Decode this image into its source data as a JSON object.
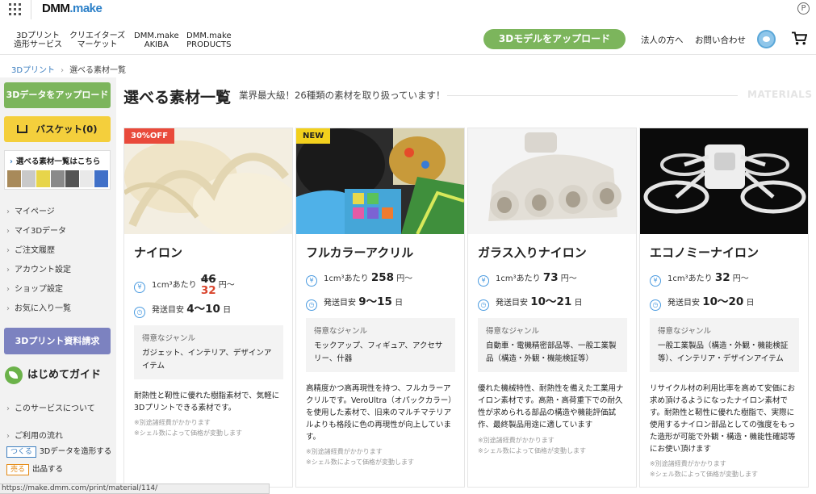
{
  "header": {
    "logo_main": "DMM",
    "logo_accent": ".make",
    "point_icon": "P",
    "nav": [
      {
        "line1": "3Dプリント",
        "line2": "造形サービス"
      },
      {
        "line1": "クリエイターズ",
        "line2": "マーケット"
      },
      {
        "line1": "DMM.make",
        "line2": "AKIBA"
      },
      {
        "line1": "DMM.make",
        "line2": "PRODUCTS"
      }
    ],
    "upload_button": "3Dモデルをアップロード",
    "corporate_link": "法人の方へ",
    "contact_link": "お問い合わせ"
  },
  "breadcrumb": {
    "home": "3Dプリント",
    "current": "選べる素材一覧"
  },
  "sidebar": {
    "upload_button": "3Dデータをアップロード",
    "basket_button": "バスケット(0)",
    "material_banner": "選べる素材一覧はこちら",
    "menu": [
      "マイページ",
      "マイ3Dデータ",
      "ご注文履歴",
      "アカウント設定",
      "ショップ設定",
      "お気に入り一覧"
    ],
    "request_button": "3Dプリント資料請求",
    "guide_title": "はじめてガイド",
    "guide_items": [
      "このサービスについて",
      "ご利用の流れ"
    ],
    "step1_tag": "つくる",
    "step1_text": "3Dデータを造形する",
    "step2_tag": "売る",
    "step2_text": "出品する"
  },
  "main": {
    "title": "選べる素材一覧",
    "subtitle": "業界最大級！26種類の素材を取り扱っています！",
    "title_en": "MATERIALS",
    "price_prefix": "1cm³あたり",
    "price_suffix": "円〜",
    "ship_prefix": "発送目安",
    "ship_suffix": "日",
    "genre_label": "得意なジャンル",
    "notes": [
      "※別途諸経費がかかります",
      "※シェル数によって価格が変動します"
    ],
    "cards": [
      {
        "badge": "30%OFF",
        "name": "ナイロン",
        "price_old": "46",
        "price": "32",
        "ship": "4〜10",
        "genre": "ガジェット、インテリア、デザインアイテム",
        "desc": "耐熱性と靭性に優れた樹脂素材で、気軽に3Dプリントできる素材です。"
      },
      {
        "badge": "NEW",
        "name": "フルカラーアクリル",
        "price": "258",
        "ship": "9〜15",
        "genre": "モックアップ、フィギュア、アクセサリー、什器",
        "desc": "高精度かつ高再現性を持つ、フルカラーアクリルです。VeroUltra（オパックカラー）を使用した素材で、旧来のマルチマテリアルよりも格段に色の再現性が向上しています。"
      },
      {
        "name": "ガラス入りナイロン",
        "price": "73",
        "ship": "10〜21",
        "genre": "自動車・電機精密部品等、一般工業製品（構造・外観・機能検証等）",
        "desc": "優れた機械特性、耐熱性を備えた工業用ナイロン素材です。高熱・高荷重下での耐久性が求められる部品の構造や機能評価試作、最終製品用途に適しています"
      },
      {
        "name": "エコノミーナイロン",
        "price": "32",
        "ship": "10〜20",
        "genre": "一般工業製品（構造・外観・機能検証等）、インテリア・デザインアイテム",
        "desc": "リサイクル材の利用比率を高めて安価にお求め頂けるようになったナイロン素材です。耐熱性と靭性に優れた樹脂で、実際に使用するナイロン部品としての強度をもった造形が可能で外観・構造・機能性確認等にお使い頂けます"
      }
    ]
  },
  "status_bar": "https://make.dmm.com/print/material/114/"
}
